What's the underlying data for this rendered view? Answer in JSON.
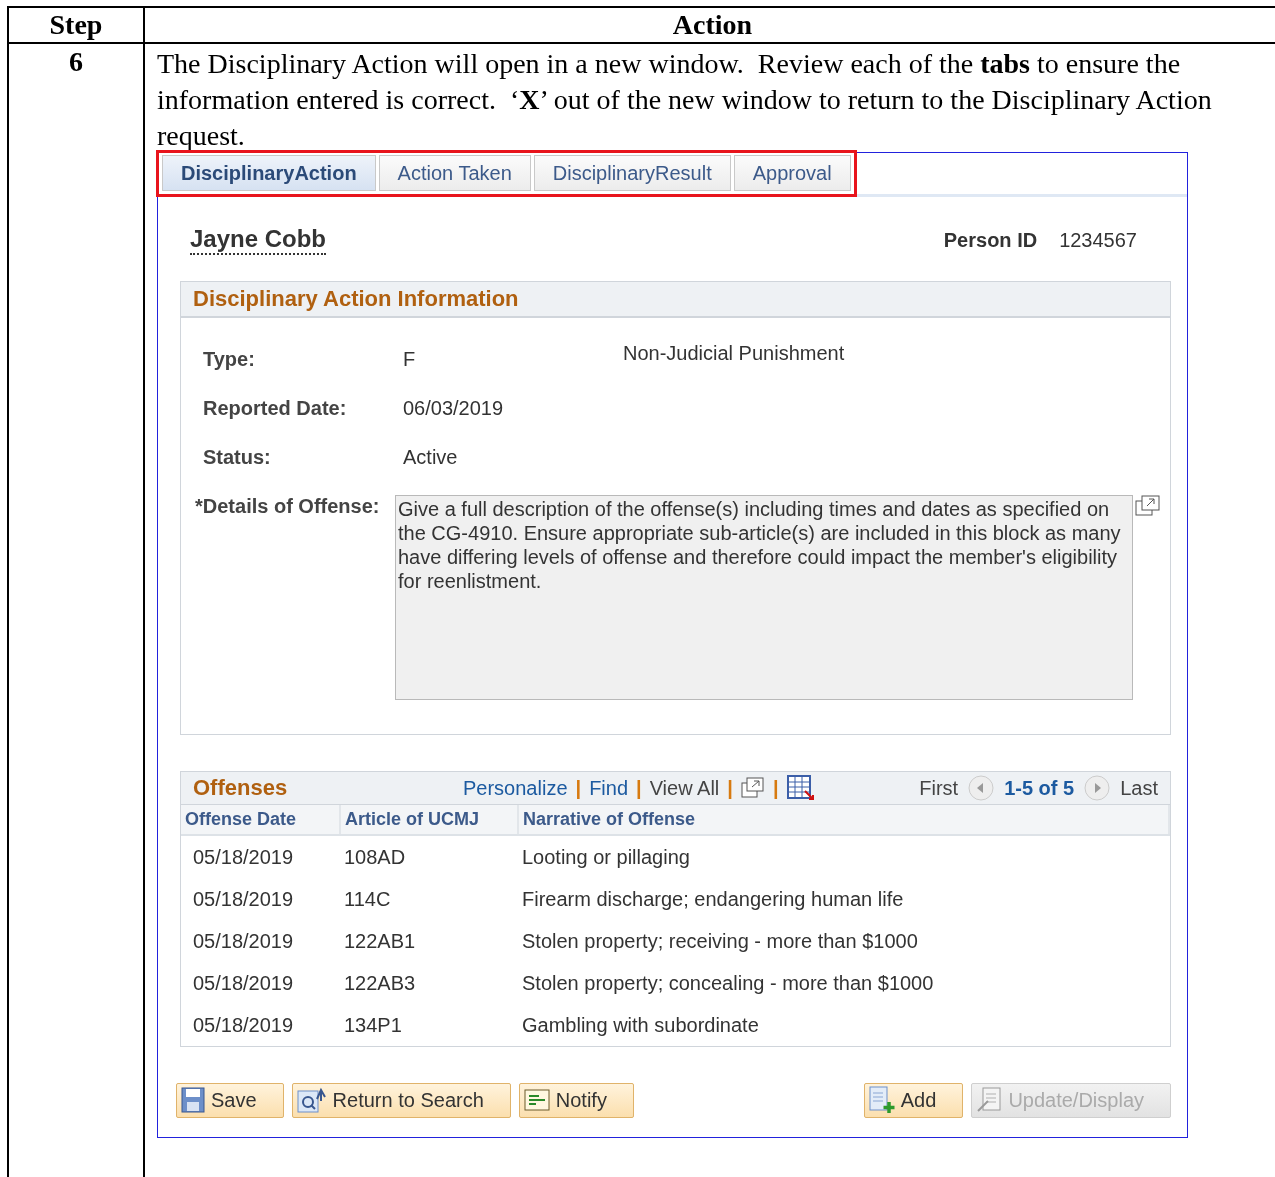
{
  "table": {
    "columns": [
      "Step",
      "Action"
    ],
    "rows": [
      {
        "step": "6",
        "instruction": "The Disciplinary Action will open in a new window.  Review each of the **tabs** to ensure the information entered is correct.  ‘**X**’ out of the new window to return to the Disciplinary Action request.",
        "screenshot": {
          "tabs": [
            {
              "label": "DisciplinaryAction",
              "selected": true
            },
            {
              "label": "Action Taken",
              "selected": false
            },
            {
              "label": "DisciplinaryResult",
              "selected": false
            },
            {
              "label": "Approval",
              "selected": false
            }
          ],
          "person_name": "Jayne Cobb",
          "person_id_label": "Person ID",
          "person_id": "1234567",
          "section_title": "Disciplinary Action Information",
          "fields": [
            {
              "label": "Type:",
              "value": "F",
              "description": "Non-Judicial Punishment"
            },
            {
              "label": "Reported Date:",
              "value": "06/03/2019"
            },
            {
              "label": "Status:",
              "value": "Active"
            }
          ],
          "details_label": "*Details of Offense:",
          "details_text": "Give a full description of the offense(s) including times and dates as specified on the CG-4910.  Ensure appropriate sub-article(s) are included in this block as many have differing levels of offense and therefore could impact the member's eligibility for reenlistment.",
          "offenses": {
            "title": "Offenses",
            "links": [
              "Personalize",
              "Find"
            ],
            "separator": "|",
            "view_all": "View All",
            "first": "First",
            "range": "1-5 of 5",
            "last": "Last",
            "columns": [
              "Offense Date",
              "Article of UCMJ",
              "Narrative of Offense"
            ],
            "rows": [
              [
                "05/18/2019",
                "108AD",
                "Looting or pillaging"
              ],
              [
                "05/18/2019",
                "114C",
                "Firearm discharge; endangering human life"
              ],
              [
                "05/18/2019",
                "122AB1",
                "Stolen property; receiving - more than $1000"
              ],
              [
                "05/18/2019",
                "122AB3",
                "Stolen property; concealing - more than $1000"
              ],
              [
                "05/18/2019",
                "134P1",
                "Gambling with subordinate"
              ]
            ]
          },
          "buttons": [
            {
              "label": "Save",
              "kind": "save",
              "disabled": false
            },
            {
              "label": "Return to Search",
              "kind": "search",
              "disabled": false
            },
            {
              "label": "Notify",
              "kind": "notify",
              "disabled": false
            },
            {
              "label": "Add",
              "kind": "add",
              "disabled": false
            },
            {
              "label": "Update/Display",
              "kind": "update",
              "disabled": true
            }
          ]
        }
      }
    ]
  }
}
